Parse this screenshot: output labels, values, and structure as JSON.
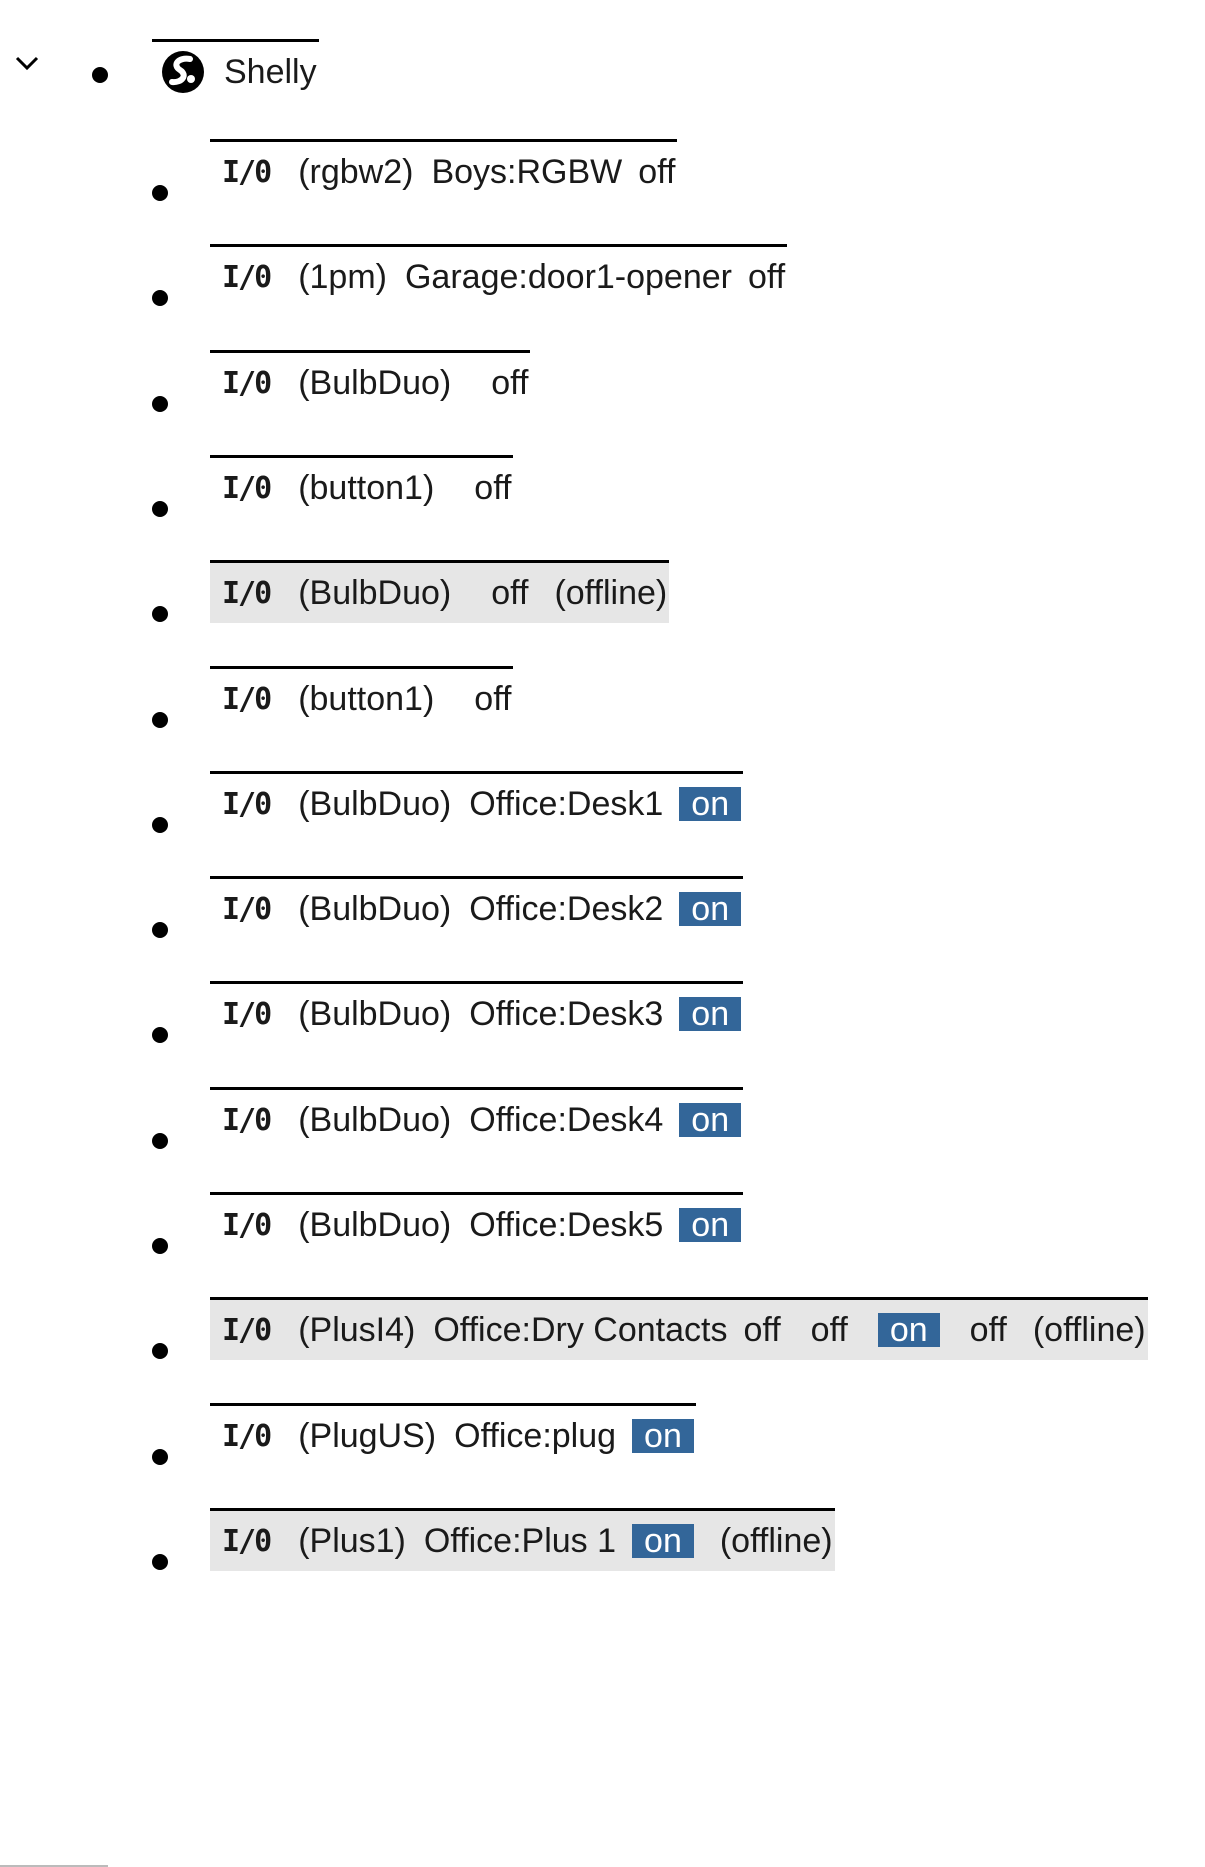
{
  "root": {
    "label": "Shelly",
    "logo_icon": "shelly-logo-icon"
  },
  "colors": {
    "on_bg": "#336699",
    "offline_bg": "#e6e6e6"
  },
  "devices": [
    {
      "type": "(rgbw2)",
      "name": "Boys:RGBW",
      "states": [
        "off"
      ],
      "status": ""
    },
    {
      "type": "(1pm)",
      "name": "Garage:door1-opener",
      "states": [
        "off"
      ],
      "status": ""
    },
    {
      "type": "(BulbDuo)",
      "name": "",
      "states": [
        "off"
      ],
      "status": ""
    },
    {
      "type": "(button1)",
      "name": "",
      "states": [
        "off"
      ],
      "status": ""
    },
    {
      "type": "(BulbDuo)",
      "name": "",
      "states": [
        "off"
      ],
      "status": "(offline)"
    },
    {
      "type": "(button1)",
      "name": "",
      "states": [
        "off"
      ],
      "status": ""
    },
    {
      "type": "(BulbDuo)",
      "name": "Office:Desk1",
      "states": [
        "on"
      ],
      "status": ""
    },
    {
      "type": "(BulbDuo)",
      "name": "Office:Desk2",
      "states": [
        "on"
      ],
      "status": ""
    },
    {
      "type": "(BulbDuo)",
      "name": "Office:Desk3",
      "states": [
        "on"
      ],
      "status": ""
    },
    {
      "type": "(BulbDuo)",
      "name": "Office:Desk4",
      "states": [
        "on"
      ],
      "status": ""
    },
    {
      "type": "(BulbDuo)",
      "name": "Office:Desk5",
      "states": [
        "on"
      ],
      "status": ""
    },
    {
      "type": "(PlusI4)",
      "name": "Office:Dry Contacts",
      "states": [
        "off",
        "off",
        "on",
        "off"
      ],
      "status": "(offline)"
    },
    {
      "type": "(PlugUS)",
      "name": "Office:plug",
      "states": [
        "on"
      ],
      "status": ""
    },
    {
      "type": "(Plus1)",
      "name": "Office:Plus 1",
      "states": [
        "on"
      ],
      "status": "(offline)"
    }
  ],
  "io_label": "I/0"
}
